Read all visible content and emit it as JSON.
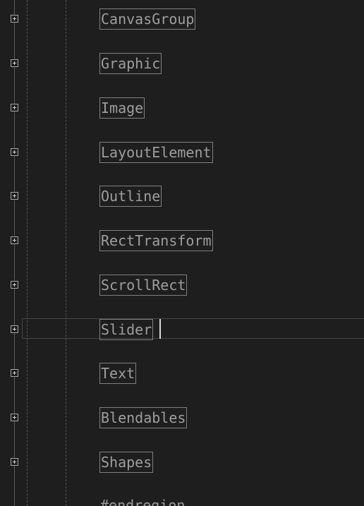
{
  "editor": {
    "regions": [
      {
        "label": "CanvasGroup"
      },
      {
        "label": "Graphic"
      },
      {
        "label": "Image"
      },
      {
        "label": "LayoutElement"
      },
      {
        "label": "Outline"
      },
      {
        "label": "RectTransform"
      },
      {
        "label": "ScrollRect"
      },
      {
        "label": "Slider"
      },
      {
        "label": "Text"
      },
      {
        "label": "Blendables"
      },
      {
        "label": "Shapes"
      }
    ],
    "endregion_text": "#endregion",
    "current_line_label": "Slider"
  }
}
